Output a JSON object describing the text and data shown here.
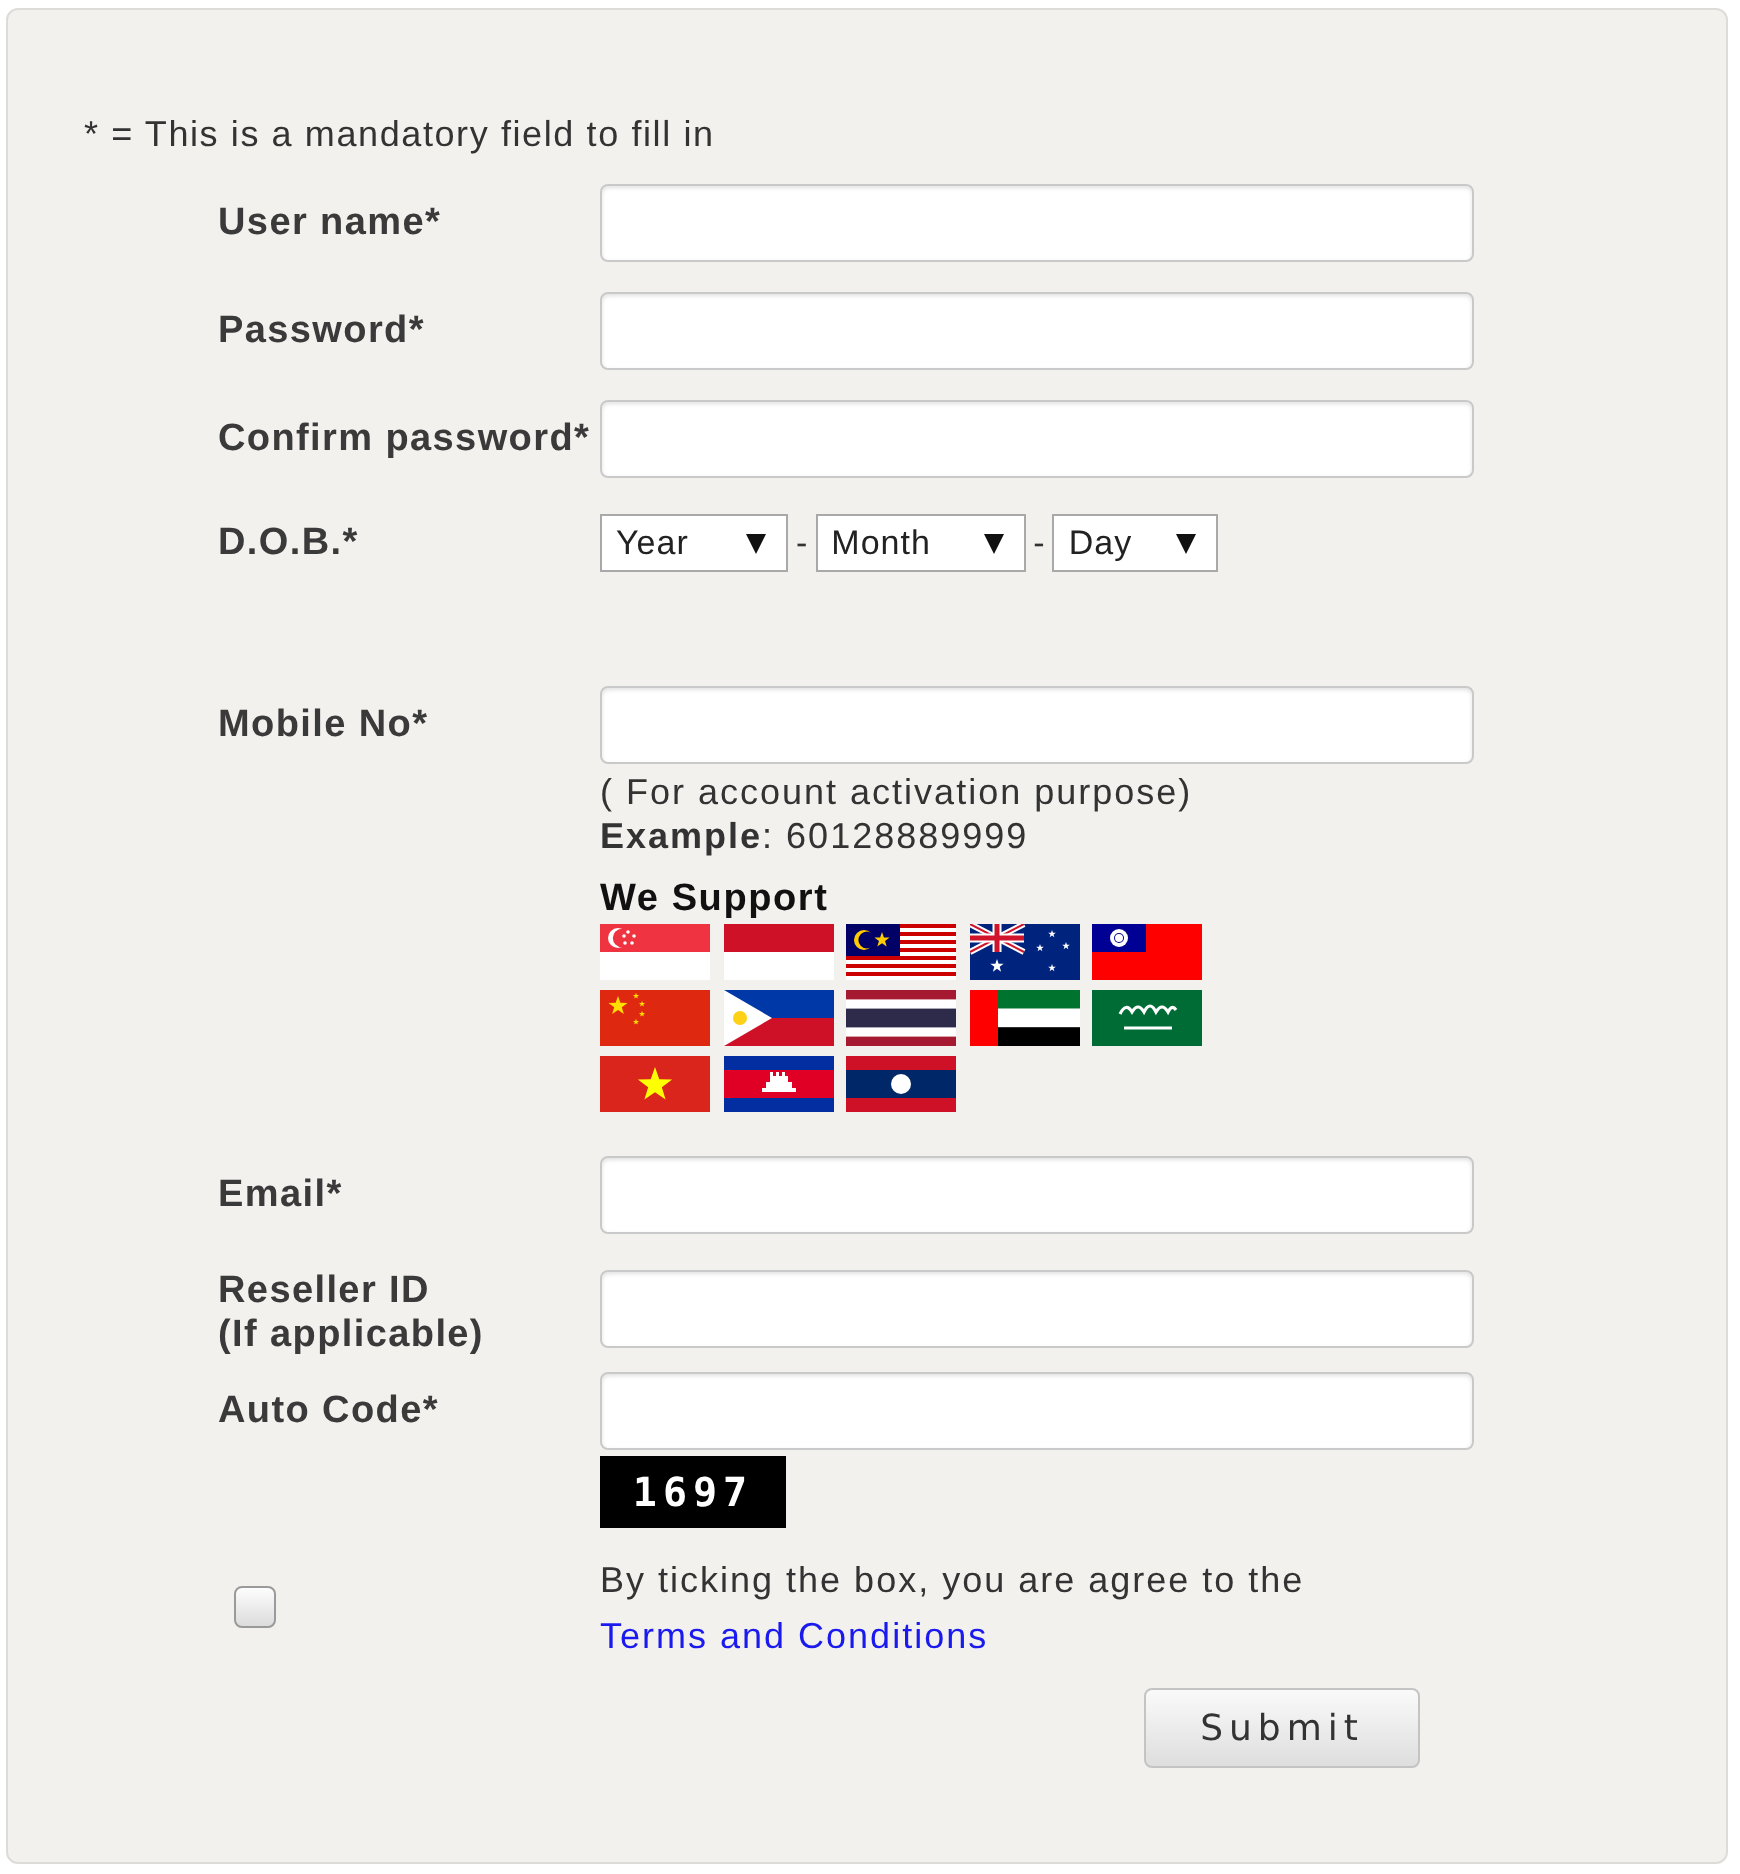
{
  "note": "* = This is a mandatory field to fill in",
  "fields": [
    {
      "kind": "text",
      "label": "User name*"
    },
    {
      "kind": "text",
      "label": "Password*"
    },
    {
      "kind": "text",
      "label": "Confirm password*"
    },
    {
      "kind": "date",
      "label": "D.O.B.*",
      "selects": [
        {
          "value": "Year"
        },
        {
          "value": "Month"
        },
        {
          "value": "Day"
        }
      ],
      "separators": [
        "-",
        "-"
      ]
    },
    {
      "kind": "mobile",
      "label": "Mobile No*",
      "hint": "( For account activation purpose)",
      "example": "**Example**: 60128889999",
      "support_title": "We Support"
    },
    {
      "kind": "text",
      "label": "Email*"
    },
    {
      "kind": "text",
      "label": "Reseller ID",
      "label_note": "(If applicable)"
    },
    {
      "kind": "captcha",
      "label": "Auto Code*",
      "code": "1697"
    }
  ],
  "agreement": {
    "checked": false,
    "text": "By ticking the box, you are agree to the",
    "link": "Terms and Conditions"
  },
  "submit": "Submit"
}
